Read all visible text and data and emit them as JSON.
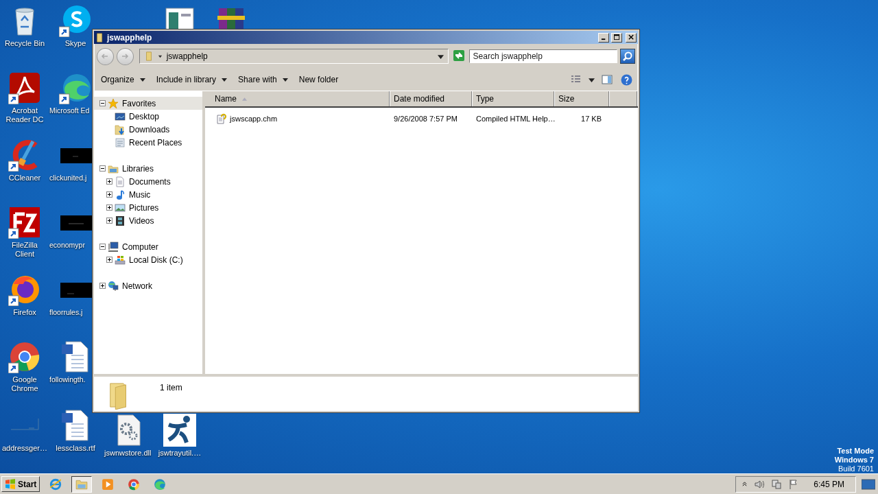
{
  "desktop": {
    "icons": [
      {
        "label": "Recycle Bin"
      },
      {
        "label": "Acrobat Reader DC"
      },
      {
        "label": "CCleaner"
      },
      {
        "label": "FileZilla Client"
      },
      {
        "label": "Firefox"
      },
      {
        "label": "Google Chrome"
      },
      {
        "label": "addressger…"
      },
      {
        "label": "Skype"
      },
      {
        "label": "Microsoft Ed"
      },
      {
        "label": "clickunited.j"
      },
      {
        "label": "economypr"
      },
      {
        "label": "floorrules.j"
      },
      {
        "label": "followingth."
      },
      {
        "label": "lessclass.rtf"
      },
      {
        "label": "jswnwstore.dll"
      },
      {
        "label": "jswtrayutil.…"
      }
    ],
    "system_notice": [
      "Test Mode",
      "Windows 7",
      "Build 7601"
    ]
  },
  "window": {
    "title": "jswapphelp",
    "address": "jswapphelp",
    "search": {
      "placeholder": "Search jswapphelp"
    },
    "toolbar": [
      {
        "label": "Organize",
        "menu": true
      },
      {
        "label": "Include in library",
        "menu": true
      },
      {
        "label": "Share with",
        "menu": true
      },
      {
        "label": "New folder",
        "menu": false
      }
    ],
    "nav": [
      {
        "label": "Favorites",
        "expanded": true,
        "selected": true,
        "children": [
          {
            "label": "Desktop",
            "selected": false
          },
          {
            "label": "Downloads",
            "selected": false
          },
          {
            "label": "Recent Places",
            "selected": false
          }
        ]
      },
      {
        "label": "Libraries",
        "expanded": true,
        "selected": false,
        "children": [
          {
            "label": "Documents",
            "expanded": false,
            "selected": false
          },
          {
            "label": "Music",
            "expanded": false,
            "selected": false
          },
          {
            "label": "Pictures",
            "expanded": false,
            "selected": false
          },
          {
            "label": "Videos",
            "expanded": false,
            "selected": false
          }
        ]
      },
      {
        "label": "Computer",
        "expanded": true,
        "selected": false,
        "children": [
          {
            "label": "Local Disk (C:)",
            "expanded": false,
            "selected": false
          }
        ]
      },
      {
        "label": "Network",
        "expanded": false,
        "selected": false
      }
    ],
    "columns": [
      {
        "label": "Name",
        "sorted": true
      },
      {
        "label": "Date modified",
        "sorted": false
      },
      {
        "label": "Type",
        "sorted": false
      },
      {
        "label": "Size",
        "sorted": false
      }
    ],
    "rows": [
      {
        "name": "jswscapp.chm",
        "date_modified": "9/26/2008 7:57 PM",
        "type": "Compiled HTML Help…",
        "size": "17 KB"
      }
    ],
    "status": "1 item"
  },
  "taskbar": {
    "start": "Start",
    "apps": [
      {
        "selected": false
      },
      {
        "selected": true
      },
      {
        "selected": false
      },
      {
        "selected": false
      },
      {
        "selected": false
      }
    ],
    "clock": "6:45 PM"
  }
}
